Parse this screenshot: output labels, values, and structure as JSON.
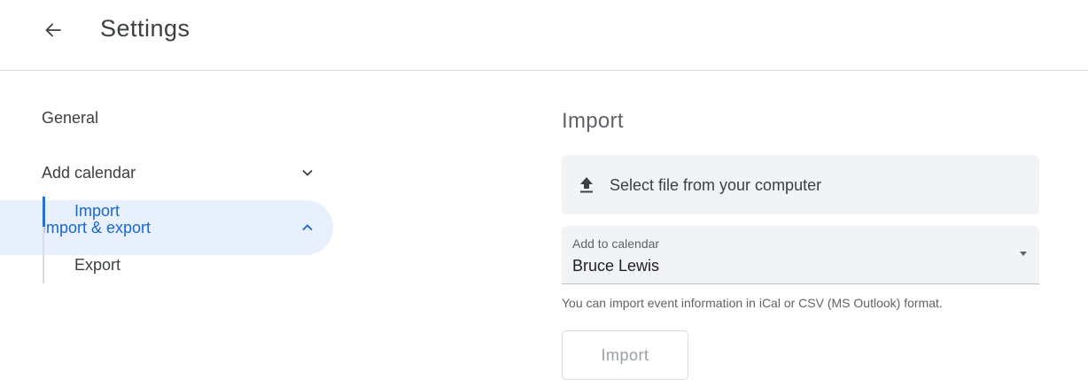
{
  "header": {
    "back_icon": "arrow-back-icon",
    "title": "Settings"
  },
  "sidebar": {
    "items": [
      {
        "label": "General"
      },
      {
        "label": "Add calendar",
        "icon": "chevron-down-icon"
      },
      {
        "label": "Import & export",
        "icon": "chevron-up-icon",
        "active": true
      }
    ],
    "sub_items": [
      {
        "label": "Import",
        "active": true
      },
      {
        "label": "Export"
      }
    ]
  },
  "main": {
    "section_title": "Import",
    "file_select": {
      "icon": "upload-icon",
      "label": "Select file from your computer"
    },
    "calendar_select": {
      "caption": "Add to calendar",
      "value": "Bruce Lewis",
      "icon": "dropdown-caret-icon"
    },
    "hint": "You can import event information in iCal or CSV (MS Outlook) format.",
    "import_button": "Import"
  },
  "colors": {
    "accent": "#1967d2",
    "active_bg": "#e8f0fe",
    "field_bg": "#f1f3f4",
    "divider": "#dadce0"
  }
}
